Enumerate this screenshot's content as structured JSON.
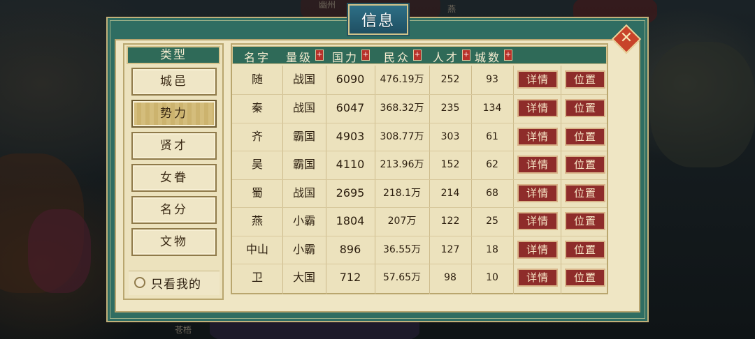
{
  "map": {
    "labels": [
      "燕",
      "幽州",
      "苍梧"
    ]
  },
  "dialog": {
    "title": "信息",
    "close_label": "✕"
  },
  "categories": {
    "header": "类型",
    "items": [
      "城邑",
      "势力",
      "贤才",
      "女眷",
      "名分",
      "文物"
    ],
    "active": "势力",
    "only_mine_label": "只看我的"
  },
  "table": {
    "columns": [
      "名字",
      "量级",
      "国力",
      "民众",
      "人才",
      "城数"
    ],
    "sort_marker": "+",
    "detail_label": "详情",
    "location_label": "位置",
    "rows": [
      {
        "name": "随",
        "rank": "战国",
        "power": "6090",
        "people": "476.19万",
        "talent": "252",
        "cities": "93"
      },
      {
        "name": "秦",
        "rank": "战国",
        "power": "6047",
        "people": "368.32万",
        "talent": "235",
        "cities": "134"
      },
      {
        "name": "齐",
        "rank": "霸国",
        "power": "4903",
        "people": "308.77万",
        "talent": "303",
        "cities": "61"
      },
      {
        "name": "吴",
        "rank": "霸国",
        "power": "4110",
        "people": "213.96万",
        "talent": "152",
        "cities": "62"
      },
      {
        "name": "蜀",
        "rank": "战国",
        "power": "2695",
        "people": "218.1万",
        "talent": "214",
        "cities": "68"
      },
      {
        "name": "燕",
        "rank": "小霸",
        "power": "1804",
        "people": "207万",
        "talent": "122",
        "cities": "25"
      },
      {
        "name": "中山",
        "rank": "小霸",
        "power": "896",
        "people": "36.55万",
        "talent": "127",
        "cities": "18"
      },
      {
        "name": "卫",
        "rank": "大国",
        "power": "712",
        "people": "57.65万",
        "talent": "98",
        "cities": "10"
      }
    ]
  },
  "colors": {
    "panel_teal": "#2f6d62",
    "parchment": "#efe6c4",
    "button_red": "#8e2c2a",
    "header_green": "#2f6a58"
  }
}
